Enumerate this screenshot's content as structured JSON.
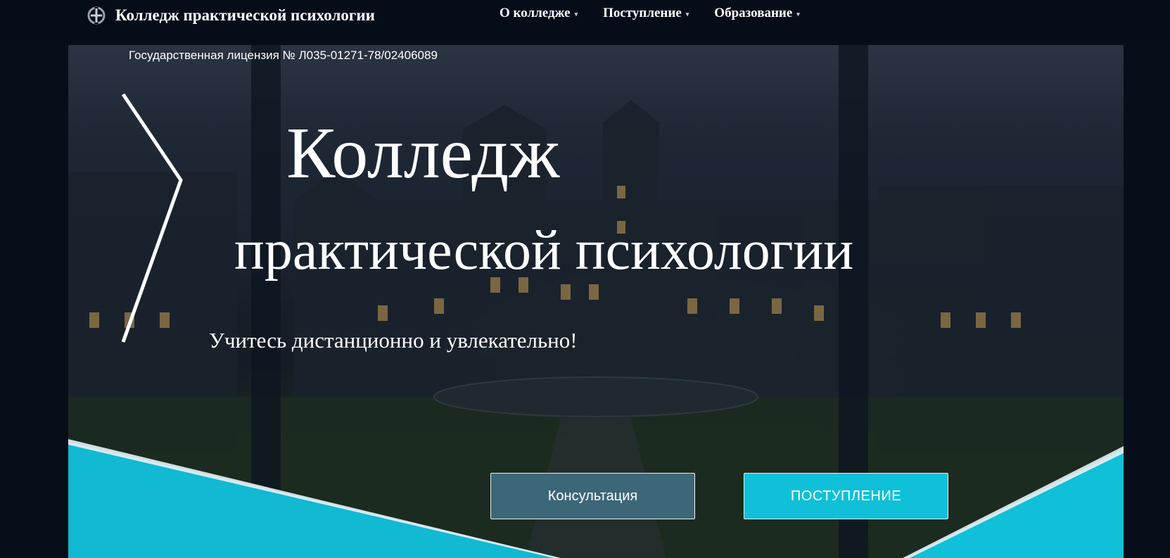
{
  "header": {
    "brand_name": "Колледж практической психологии",
    "nav": [
      {
        "label": "О колледже"
      },
      {
        "label": "Поступление"
      },
      {
        "label": "Образование"
      }
    ],
    "caret": "▾"
  },
  "hero": {
    "license": "Государственная лицензия № Л035-01271-78/02406089",
    "title_line1": "Колледж",
    "title_line2": "практической психологии",
    "subtitle": "Учитесь дистанционно и увлекательно!",
    "buttons": {
      "consult": "Консультация",
      "admission": "ПОСТУПЛЕНИЕ"
    }
  },
  "colors": {
    "page_background": "#060e19",
    "accent_cyan": "#0fc0d8",
    "consult_button": "#3c6778"
  }
}
